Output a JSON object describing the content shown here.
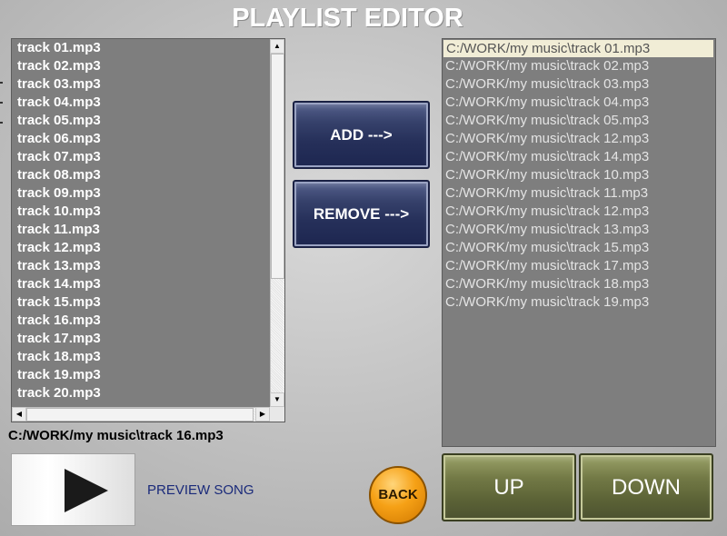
{
  "title": "PLAYLIST EDITOR",
  "file_list": {
    "items": [
      "track 01.mp3",
      "track 02.mp3",
      "track 03.mp3",
      "track 04.mp3",
      "track 05.mp3",
      "track 06.mp3",
      "track 07.mp3",
      "track 08.mp3",
      "track 09.mp3",
      "track 10.mp3",
      "track 11.mp3",
      "track 12.mp3",
      "track 13.mp3",
      "track 14.mp3",
      "track 15.mp3",
      "track 16.mp3",
      "track 17.mp3",
      "track 18.mp3",
      "track 19.mp3",
      "track 20.mp3"
    ]
  },
  "current_path": "C:/WORK/my music\\track 16.mp3",
  "buttons": {
    "add": "ADD --->",
    "remove": "REMOVE --->",
    "back": "BACK",
    "up": "UP",
    "down": "DOWN"
  },
  "preview_label": "PREVIEW SONG",
  "playlist": {
    "selected_index": 0,
    "items": [
      "C:/WORK/my music\\track 01.mp3",
      "C:/WORK/my music\\track 02.mp3",
      "C:/WORK/my music\\track 03.mp3",
      "C:/WORK/my music\\track 04.mp3",
      "C:/WORK/my music\\track 05.mp3",
      "C:/WORK/my music\\track 12.mp3",
      "C:/WORK/my music\\track 14.mp3",
      "C:/WORK/my music\\track 10.mp3",
      "C:/WORK/my music\\track 11.mp3",
      "C:/WORK/my music\\track 12.mp3",
      "C:/WORK/my music\\track 13.mp3",
      "C:/WORK/my music\\track 15.mp3",
      "C:/WORK/my music\\track 17.mp3",
      "C:/WORK/my music\\track 18.mp3",
      "C:/WORK/my music\\track 19.mp3"
    ]
  },
  "icons": {
    "scroll_up": "triangle-up",
    "scroll_down": "triangle-down",
    "scroll_left": "triangle-left",
    "scroll_right": "triangle-right",
    "play": "play-triangle"
  },
  "colors": {
    "list_background": "#7e7e7e",
    "selected_row": "#f1edd6",
    "blue_button": "#2b3562",
    "olive_button": "#6a7140",
    "back_button": "#f6a116",
    "preview_text": "#1a2a7a"
  }
}
